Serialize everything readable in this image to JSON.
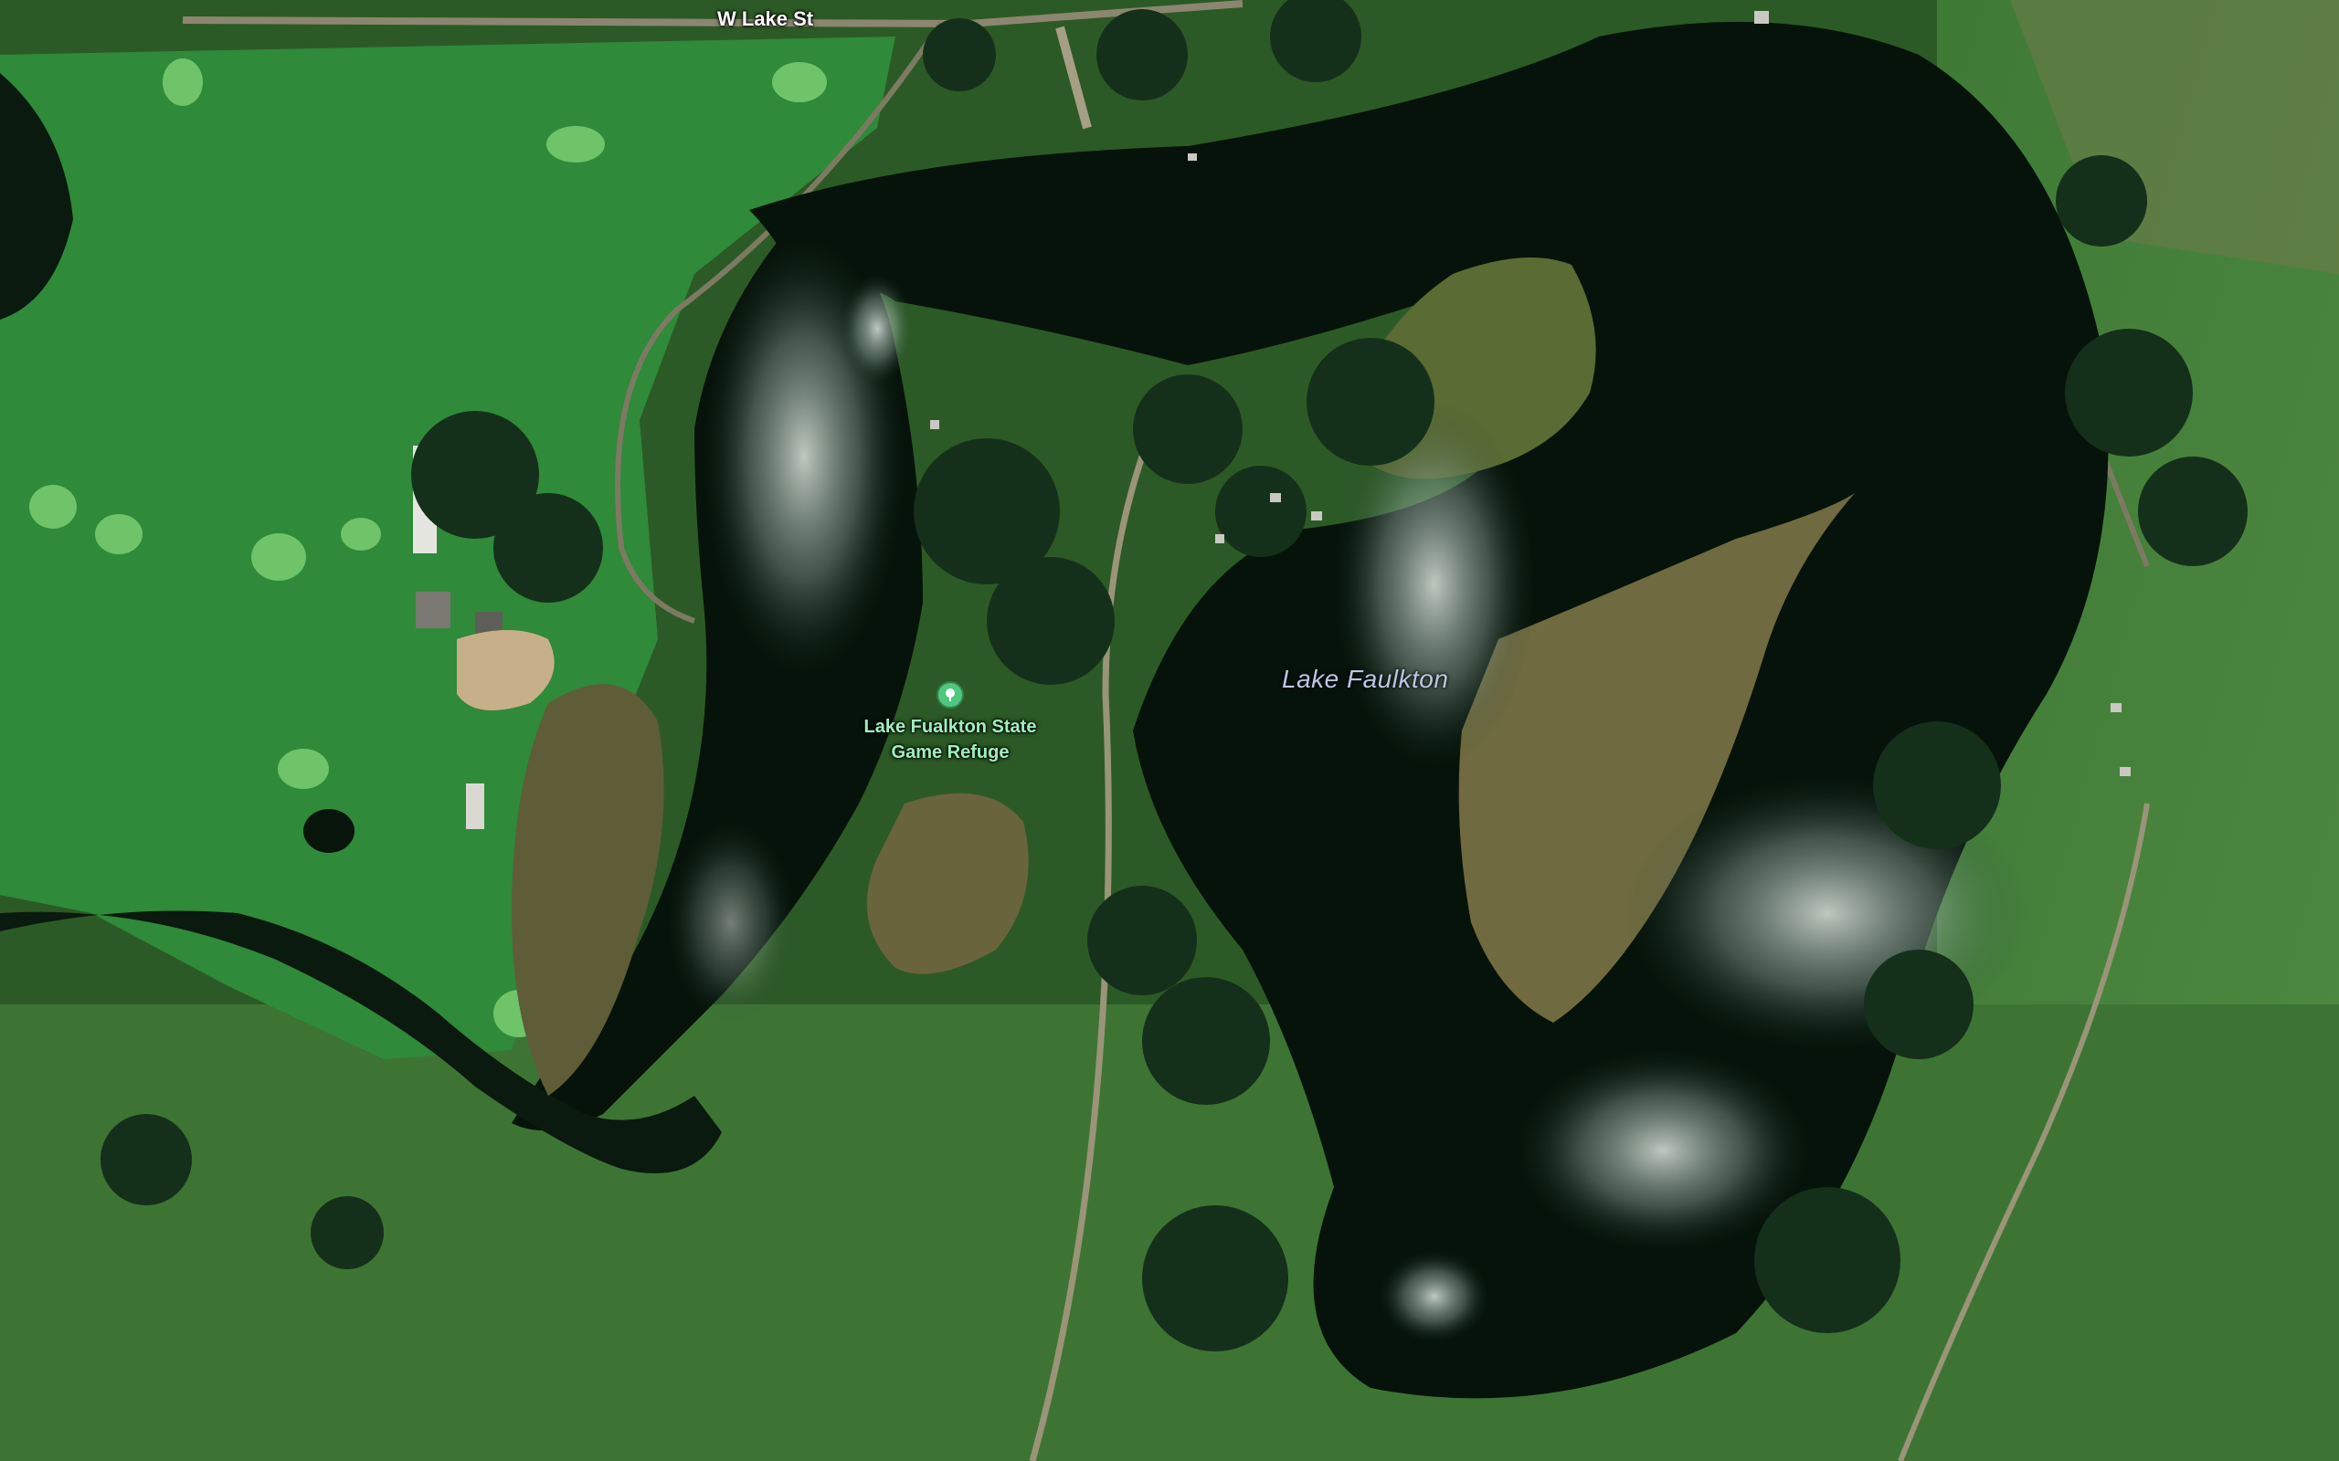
{
  "map": {
    "labels": {
      "road_name": "W Lake St",
      "lake_name": "Lake Faulkton",
      "poi_name_line1": "Lake Fualkton State",
      "poi_name_line2": "Game Refuge"
    },
    "poi_icon": "tree-icon",
    "colors": {
      "water": "#06130a",
      "grass": "#2f6a2a",
      "golf_course": "#2f8a3a",
      "marsh": "#6f6a3f",
      "poi_accent": "#4fc77f",
      "poi_text": "#9ff0bf",
      "water_label": "#b9c7e3",
      "road_label": "#ffffff"
    }
  }
}
